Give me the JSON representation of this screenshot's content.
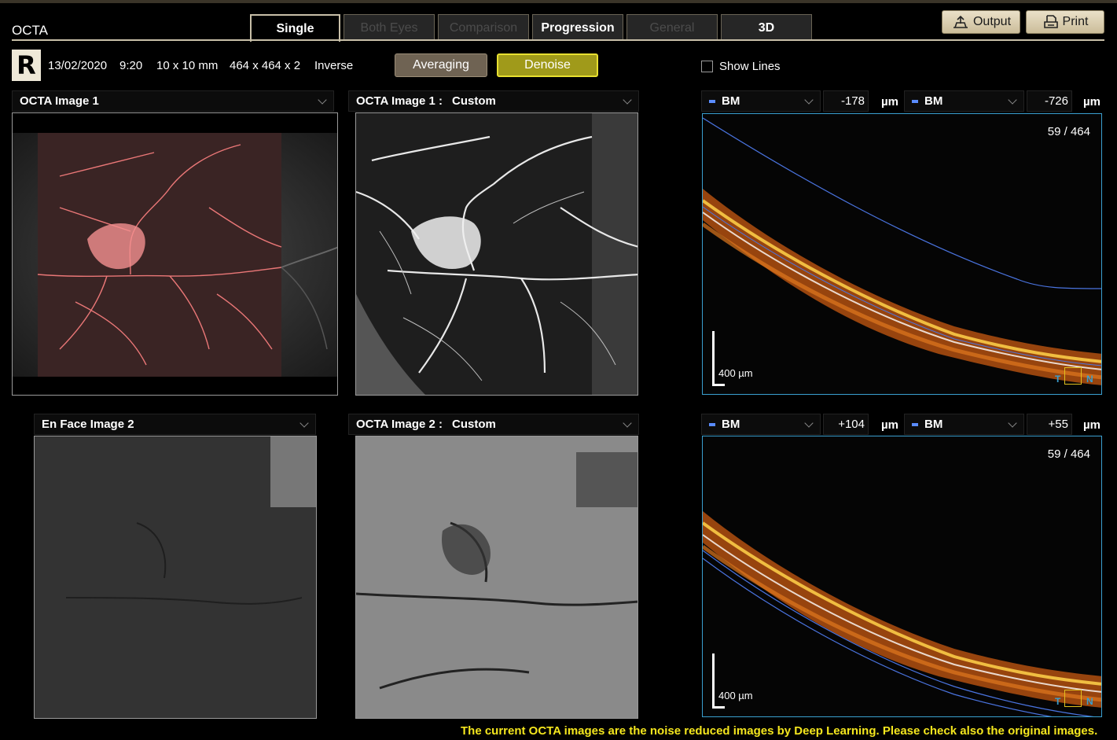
{
  "app_title": "OCTA",
  "tabs": [
    {
      "label": "Single",
      "state": "active"
    },
    {
      "label": "Both Eyes",
      "state": "disabled"
    },
    {
      "label": "Comparison",
      "state": "disabled"
    },
    {
      "label": "Progression",
      "state": "enabled"
    },
    {
      "label": "General",
      "state": "disabled"
    },
    {
      "label": "3D",
      "state": "enabled"
    }
  ],
  "toolbar": {
    "output_label": "Output",
    "print_label": "Print",
    "output_icon": "export-icon",
    "print_icon": "printer-icon"
  },
  "scan_info": {
    "eye": "R",
    "date": "13/02/2020",
    "time": "9:20",
    "size": "10 x 10 mm",
    "resolution": "464 x 464 x 2",
    "mode": "Inverse"
  },
  "processing": {
    "averaging_label": "Averaging",
    "denoise_label": "Denoise",
    "denoise_active": true
  },
  "show_lines": {
    "label": "Show Lines",
    "checked": false
  },
  "panels": {
    "octa1_select": "OCTA Image 1",
    "octa1_label": "OCTA Image 1 :",
    "octa1_preset": "Custom",
    "enface2_select": "En Face Image 2",
    "octa2_label": "OCTA Image 2 :",
    "octa2_preset": "Custom"
  },
  "bscan_top": {
    "left_layer": "BM",
    "left_offset": "-178",
    "right_layer": "BM",
    "right_offset": "-726",
    "unit": "µm",
    "frame": "59 / 464",
    "scale": "400 µm",
    "orient_t": "T",
    "orient_n": "N"
  },
  "bscan_bottom": {
    "left_layer": "BM",
    "left_offset": "+104",
    "right_layer": "BM",
    "right_offset": "+55",
    "unit": "µm",
    "frame": "59 / 464",
    "scale": "400 µm",
    "orient_t": "T",
    "orient_n": "N"
  },
  "footer_note": "The current OCTA images are the noise reduced images by Deep Learning. Please check also the original images.",
  "colors": {
    "accent": "#c8bfa8",
    "denoise": "#a09a1a",
    "footer": "#f4e61e",
    "bscan_border": "#3aa0d0",
    "layer_line": "#5a8cff"
  }
}
